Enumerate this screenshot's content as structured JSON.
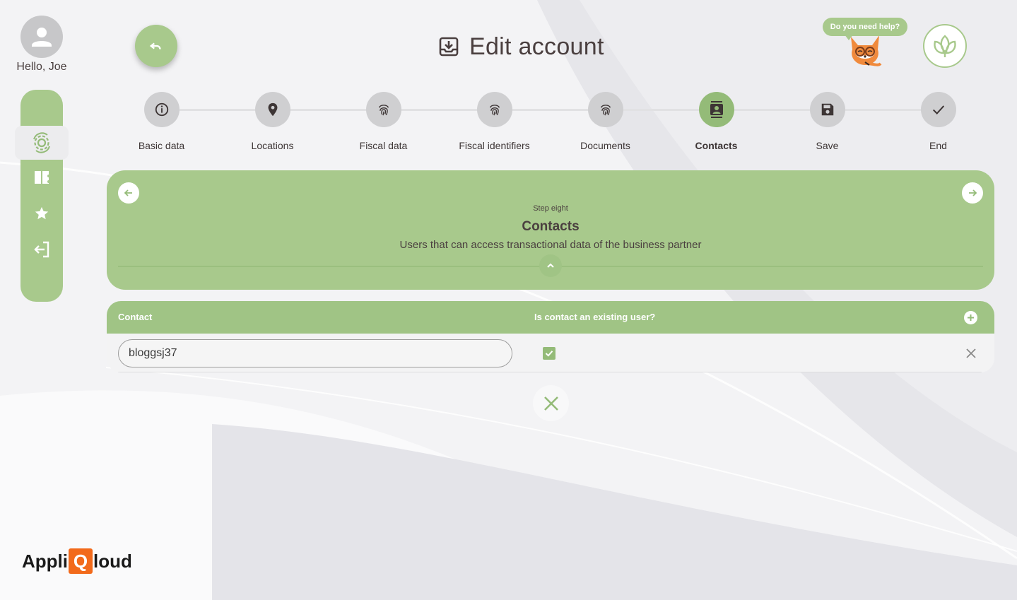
{
  "user": {
    "greeting": "Hello, Joe"
  },
  "header": {
    "title": "Edit account",
    "help_text": "Do you need help?"
  },
  "stepper": {
    "steps": [
      {
        "label": "Basic data",
        "icon": "info-icon",
        "active": false
      },
      {
        "label": "Locations",
        "icon": "location-pin-icon",
        "active": false
      },
      {
        "label": "Fiscal data",
        "icon": "fingerprint-icon",
        "active": false
      },
      {
        "label": "Fiscal identifiers",
        "icon": "fingerprint-icon",
        "active": false
      },
      {
        "label": "Documents",
        "icon": "fingerprint-icon",
        "active": false
      },
      {
        "label": "Contacts",
        "icon": "contacts-icon",
        "active": true
      },
      {
        "label": "Save",
        "icon": "save-icon",
        "active": false
      },
      {
        "label": "End",
        "icon": "check-icon",
        "active": false
      }
    ]
  },
  "info": {
    "eyebrow": "Step eight",
    "title": "Contacts",
    "description": "Users that can access transactional data of the business partner"
  },
  "table": {
    "columns": [
      "Contact",
      "Is contact an existing user?"
    ],
    "rows": [
      {
        "contact": "bloggsj37",
        "existing_user": true
      }
    ]
  },
  "brand": {
    "prefix": "Appli",
    "mark": "Q",
    "suffix": "loud"
  },
  "colors": {
    "accent": "#a8c98c",
    "accent_dark": "#94bb78",
    "text": "#4a3f3f",
    "brand_orange": "#f26a1b"
  }
}
